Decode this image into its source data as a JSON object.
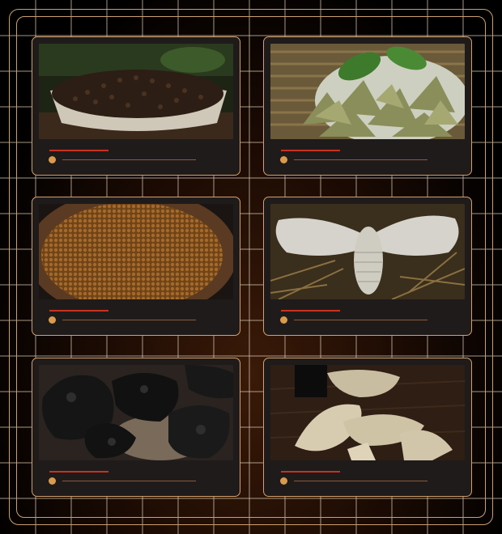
{
  "cards": [
    {
      "image": "dark-seeds-in-white-bowl"
    },
    {
      "image": "dried-green-leaves-on-plate"
    },
    {
      "image": "brown-seeds-in-wooden-bowl"
    },
    {
      "image": "silkworm-moth-on-roots"
    },
    {
      "image": "black-charred-pieces"
    },
    {
      "image": "pale-dried-root-slices"
    }
  ],
  "colors": {
    "frame": "#caa070",
    "card_border": "#d4a06a",
    "card_bg": "#1f1b1b",
    "accent_red": "#c8321e",
    "accent_gold": "#d99b4c"
  }
}
